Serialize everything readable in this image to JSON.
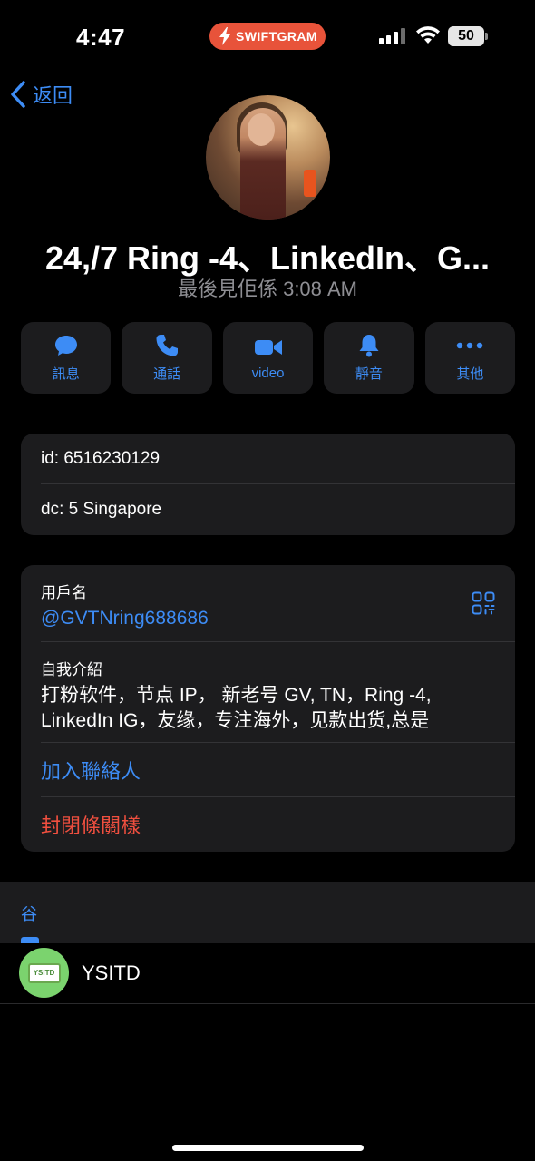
{
  "status": {
    "time": "4:47",
    "brand": "SWIFTGRAM",
    "battery": "50"
  },
  "nav": {
    "back_label": "返回"
  },
  "profile": {
    "name": "24,/7 Ring -4、LinkedIn、G...",
    "last_seen": "最後見佢係 3:08 AM"
  },
  "actions": [
    {
      "label": "訊息",
      "icon": "message-icon"
    },
    {
      "label": "通話",
      "icon": "phone-icon"
    },
    {
      "label": "video",
      "icon": "video-icon"
    },
    {
      "label": "靜音",
      "icon": "bell-icon"
    },
    {
      "label": "其他",
      "icon": "more-icon"
    }
  ],
  "info": {
    "id": "id: 6516230129",
    "dc": "dc: 5 Singapore"
  },
  "details": {
    "username_label": "用戶名",
    "username": "@GVTNring688686",
    "bio_label": "自我介紹",
    "bio": "打粉软件，节点 IP，  新老号 GV, TN，Ring -4,\nLinkedIn IG，友缘，专注海外，见款出货,总是",
    "add_contact": "加入聯絡人",
    "block_user": "封閉條關樣"
  },
  "tabs": {
    "active": "谷"
  },
  "groups": [
    {
      "name": "YSITD",
      "avatar_text": "YSITD"
    }
  ],
  "colors": {
    "accent": "#3d8cf5",
    "destructive": "#ef4f3f",
    "brand": "#e8533a"
  }
}
